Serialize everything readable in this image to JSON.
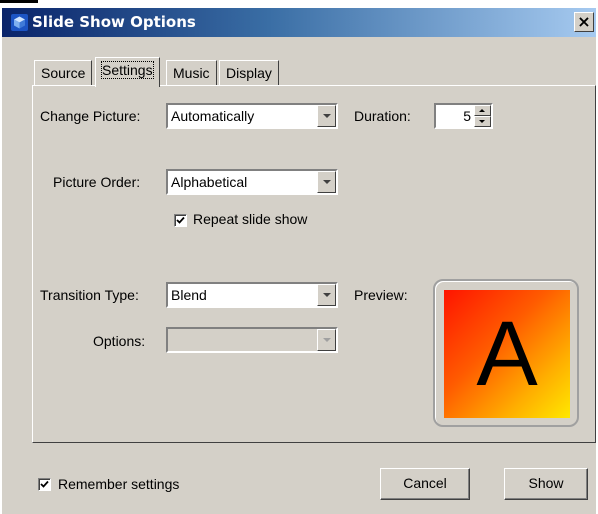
{
  "window": {
    "title": "Slide Show Options",
    "close_label": "×"
  },
  "tabs": [
    {
      "label": "Source",
      "active": false
    },
    {
      "label": "Settings",
      "active": true
    },
    {
      "label": "Music",
      "active": false
    },
    {
      "label": "Display",
      "active": false
    }
  ],
  "settings": {
    "change_picture_label": "Change Picture:",
    "change_picture_value": "Automatically",
    "duration_label": "Duration:",
    "duration_value": "5",
    "picture_order_label": "Picture Order:",
    "picture_order_value": "Alphabetical",
    "repeat_label": "Repeat slide show",
    "repeat_checked": true,
    "transition_label": "Transition Type:",
    "transition_value": "Blend",
    "preview_label": "Preview:",
    "preview_letter": "A",
    "options_label": "Options:",
    "options_value": ""
  },
  "footer": {
    "remember_label": "Remember settings",
    "remember_checked": true,
    "cancel_label": "Cancel",
    "show_label": "Show"
  },
  "colors": {
    "dialog_bg": "#d4d0c8",
    "titlebar_start": "#0a246a",
    "titlebar_end": "#a6caf0",
    "preview_gradient_start": "#ff1400",
    "preview_gradient_end": "#ffe800"
  },
  "icons": {
    "title": "app-cube-icon",
    "close": "close-icon",
    "dropdown": "chevron-down-icon",
    "check": "checkmark-icon"
  }
}
